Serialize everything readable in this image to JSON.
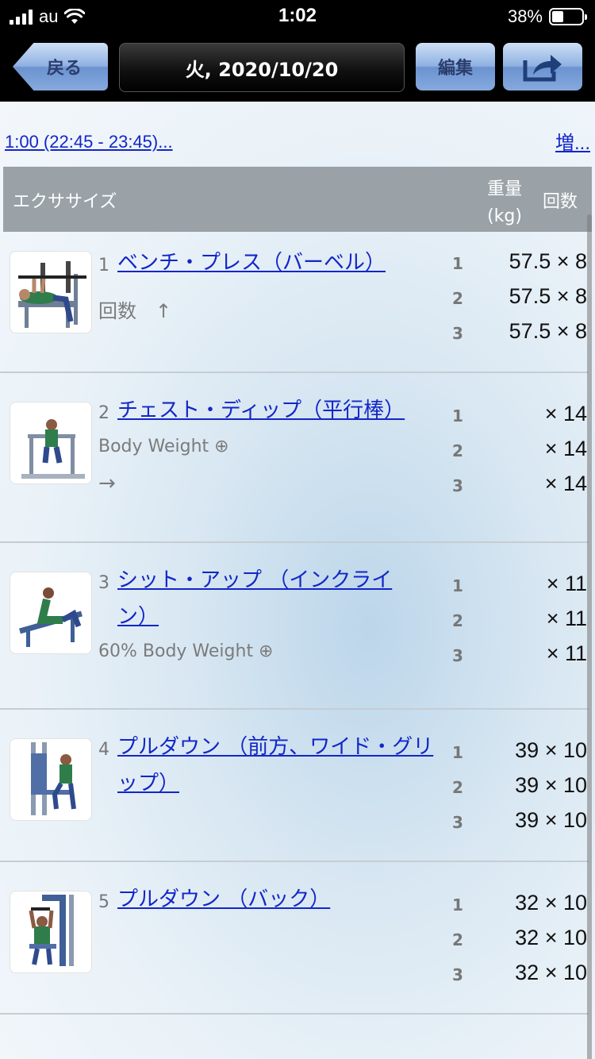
{
  "status": {
    "carrier": "au",
    "time": "1:02",
    "battery": "38%",
    "battery_level": 0.38
  },
  "nav": {
    "back_label": "戻る",
    "title": "火, 2020/10/20",
    "edit_label": "編集",
    "share_icon": "share-icon"
  },
  "summary": {
    "duration_link": "1:00 (22:45 - 23:45)...",
    "more_link": "増..."
  },
  "table_header": {
    "exercise": "エクササイズ",
    "weight_line1": "重量",
    "weight_line2": "(kg)",
    "reps": "回数"
  },
  "exercises": [
    {
      "number": "1",
      "name": "ベンチ・プレス（バーベル）",
      "sub": "回数　↑",
      "sub2": "",
      "sets": [
        {
          "no": "1",
          "value": "57.5 × 8"
        },
        {
          "no": "2",
          "value": "57.5 × 8"
        },
        {
          "no": "3",
          "value": "57.5 × 8"
        }
      ]
    },
    {
      "number": "2",
      "name": "チェスト・ディップ（平行棒）",
      "sub": "Body Weight ⊕",
      "sub2": "→",
      "sets": [
        {
          "no": "1",
          "value": "× 14"
        },
        {
          "no": "2",
          "value": "× 14"
        },
        {
          "no": "3",
          "value": "× 14"
        }
      ]
    },
    {
      "number": "3",
      "name": "シット・アップ （インクライン）",
      "sub": "60% Body Weight ⊕",
      "sub2": "",
      "sets": [
        {
          "no": "1",
          "value": "× 11"
        },
        {
          "no": "2",
          "value": "× 11"
        },
        {
          "no": "3",
          "value": "× 11"
        }
      ]
    },
    {
      "number": "4",
      "name": "プルダウン （前方、ワイド・グリップ）",
      "sub": "",
      "sub2": "",
      "sets": [
        {
          "no": "1",
          "value": "39 × 10"
        },
        {
          "no": "2",
          "value": "39 × 10"
        },
        {
          "no": "3",
          "value": "39 × 10"
        }
      ]
    },
    {
      "number": "5",
      "name": "プルダウン （バック）",
      "sub": "",
      "sub2": "",
      "sets": [
        {
          "no": "1",
          "value": "32 × 10"
        },
        {
          "no": "2",
          "value": "32 × 10"
        },
        {
          "no": "3",
          "value": "32 × 10"
        }
      ]
    }
  ]
}
